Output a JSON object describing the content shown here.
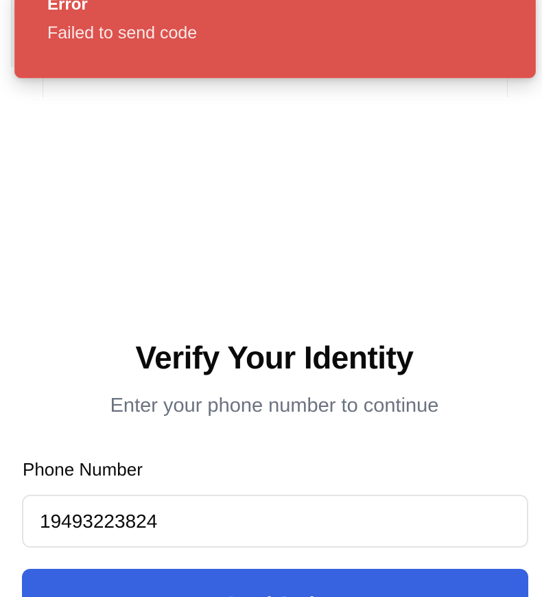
{
  "toast": {
    "title": "Error",
    "description": "Failed to send code",
    "background_color": "#dc524d"
  },
  "verify": {
    "heading": "Verify Your Identity",
    "subheading": "Enter your phone number to continue"
  },
  "form": {
    "phone_label": "Phone Number",
    "phone_value": "19493223824",
    "send_button_label": "Send Code",
    "button_color": "#3763e0"
  }
}
